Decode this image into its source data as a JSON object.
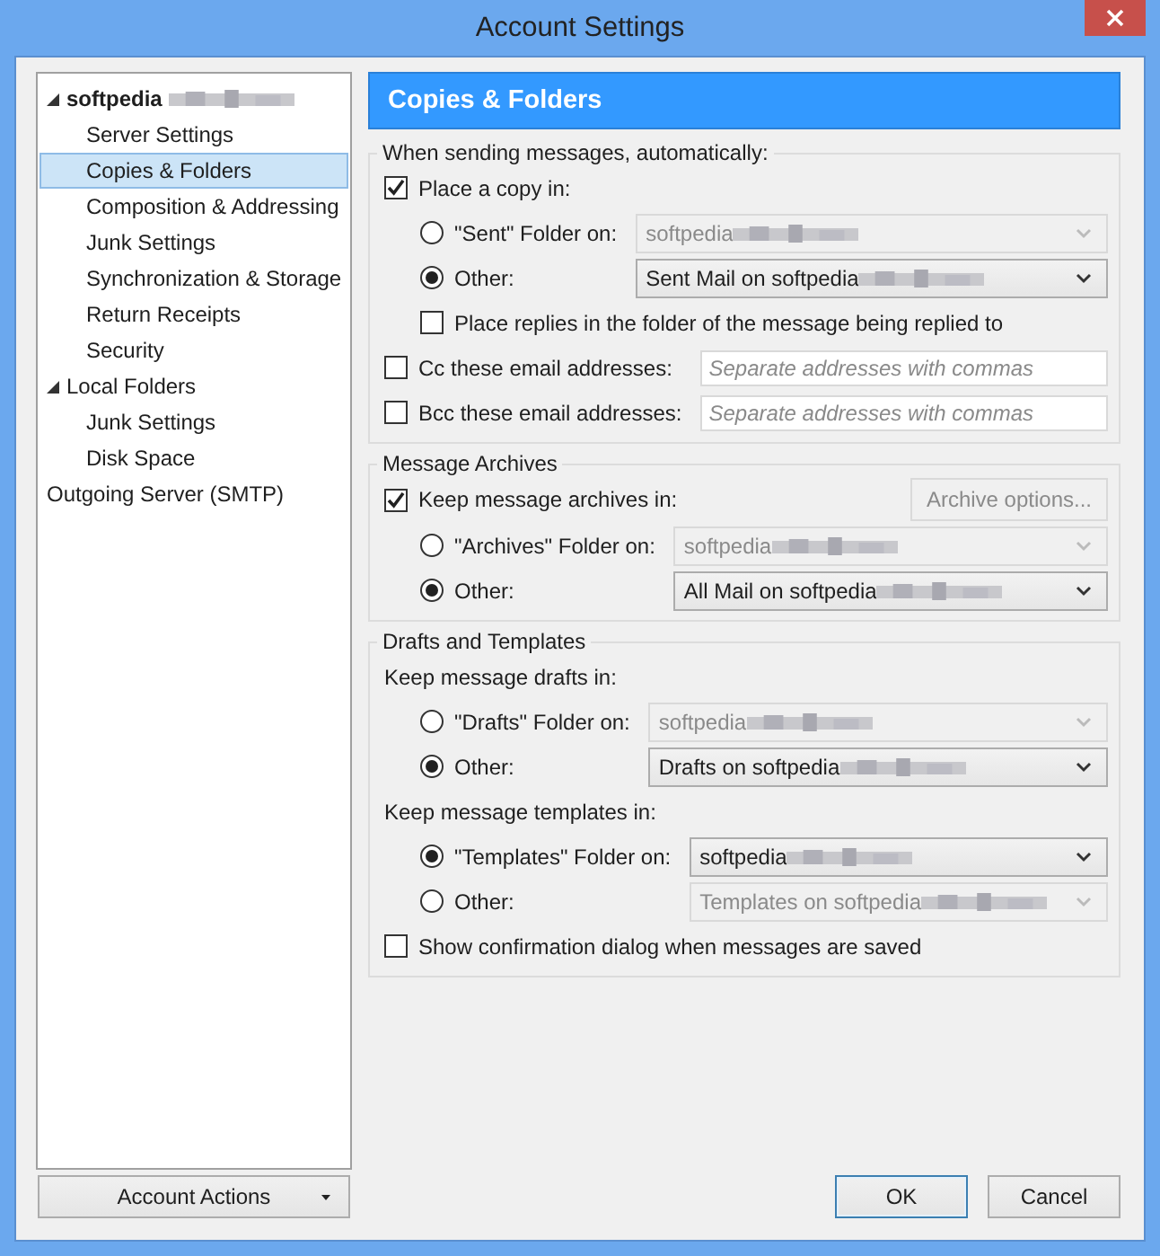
{
  "window": {
    "title": "Account Settings"
  },
  "sidebar": {
    "tree": [
      {
        "label": "softpedia",
        "redacted": true,
        "expanded": true,
        "selected": false,
        "children": [
          {
            "label": "Server Settings",
            "selected": false
          },
          {
            "label": "Copies & Folders",
            "selected": true
          },
          {
            "label": "Composition & Addressing",
            "selected": false
          },
          {
            "label": "Junk Settings",
            "selected": false
          },
          {
            "label": "Synchronization & Storage",
            "selected": false
          },
          {
            "label": "Return Receipts",
            "selected": false
          },
          {
            "label": "Security",
            "selected": false
          }
        ]
      },
      {
        "label": "Local Folders",
        "expanded": true,
        "selected": false,
        "children": [
          {
            "label": "Junk Settings",
            "selected": false
          },
          {
            "label": "Disk Space",
            "selected": false
          }
        ]
      },
      {
        "label": "Outgoing Server (SMTP)",
        "selected": false
      }
    ],
    "account_actions": "Account Actions"
  },
  "panel_title": "Copies & Folders",
  "groups": [
    {
      "legend": "When sending messages, automatically:",
      "rows": [
        {
          "kind": "checkbox",
          "label": "Place a copy in:",
          "checked": true,
          "children": [
            {
              "kind": "radio",
              "label": "\"Sent\" Folder on:",
              "selected": false,
              "dropdown": {
                "value": "softpedia",
                "redacted": true,
                "disabled": true
              }
            },
            {
              "kind": "radio",
              "label": "Other:",
              "selected": true,
              "dropdown": {
                "value": "Sent Mail on softpedia",
                "redacted": true,
                "disabled": false
              }
            },
            {
              "kind": "checkbox",
              "label": "Place replies in the folder of the message being replied to",
              "checked": false
            }
          ]
        },
        {
          "kind": "checkbox",
          "label": "Cc these email addresses:",
          "checked": false,
          "field": {
            "placeholder": "Separate addresses with commas"
          }
        },
        {
          "kind": "checkbox",
          "label": "Bcc these email addresses:",
          "checked": false,
          "field": {
            "placeholder": "Separate addresses with commas"
          }
        }
      ]
    },
    {
      "legend": "Message Archives",
      "rows": [
        {
          "kind": "checkbox",
          "label": "Keep message archives in:",
          "checked": true,
          "button": "Archive options...",
          "children": [
            {
              "kind": "radio",
              "label": "\"Archives\" Folder on:",
              "selected": false,
              "dropdown": {
                "value": "softpedia",
                "redacted": true,
                "disabled": true
              }
            },
            {
              "kind": "radio",
              "label": "Other:",
              "selected": true,
              "dropdown": {
                "value": "All Mail on softpedia",
                "redacted": true,
                "disabled": false
              }
            }
          ]
        }
      ]
    },
    {
      "legend": "Drafts and Templates",
      "rows": [
        {
          "kind": "heading",
          "label": "Keep message drafts in:",
          "children": [
            {
              "kind": "radio",
              "label": "\"Drafts\" Folder on:",
              "selected": false,
              "dropdown": {
                "value": "softpedia",
                "redacted": true,
                "disabled": true
              }
            },
            {
              "kind": "radio",
              "label": "Other:",
              "selected": true,
              "dropdown": {
                "value": "Drafts on softpedia",
                "redacted": true,
                "disabled": false
              }
            }
          ]
        },
        {
          "kind": "heading",
          "label": "Keep message templates in:",
          "children": [
            {
              "kind": "radio",
              "label": "\"Templates\" Folder on:",
              "selected": true,
              "dropdown": {
                "value": "softpedia",
                "redacted": true,
                "disabled": false
              }
            },
            {
              "kind": "radio",
              "label": "Other:",
              "selected": false,
              "dropdown": {
                "value": "Templates on softpedia",
                "redacted": true,
                "disabled": true
              }
            }
          ]
        },
        {
          "kind": "checkbox",
          "label": "Show confirmation dialog when messages are saved",
          "checked": false
        }
      ]
    }
  ],
  "buttons": [
    {
      "label": "OK",
      "default": true
    },
    {
      "label": "Cancel",
      "default": false
    }
  ]
}
